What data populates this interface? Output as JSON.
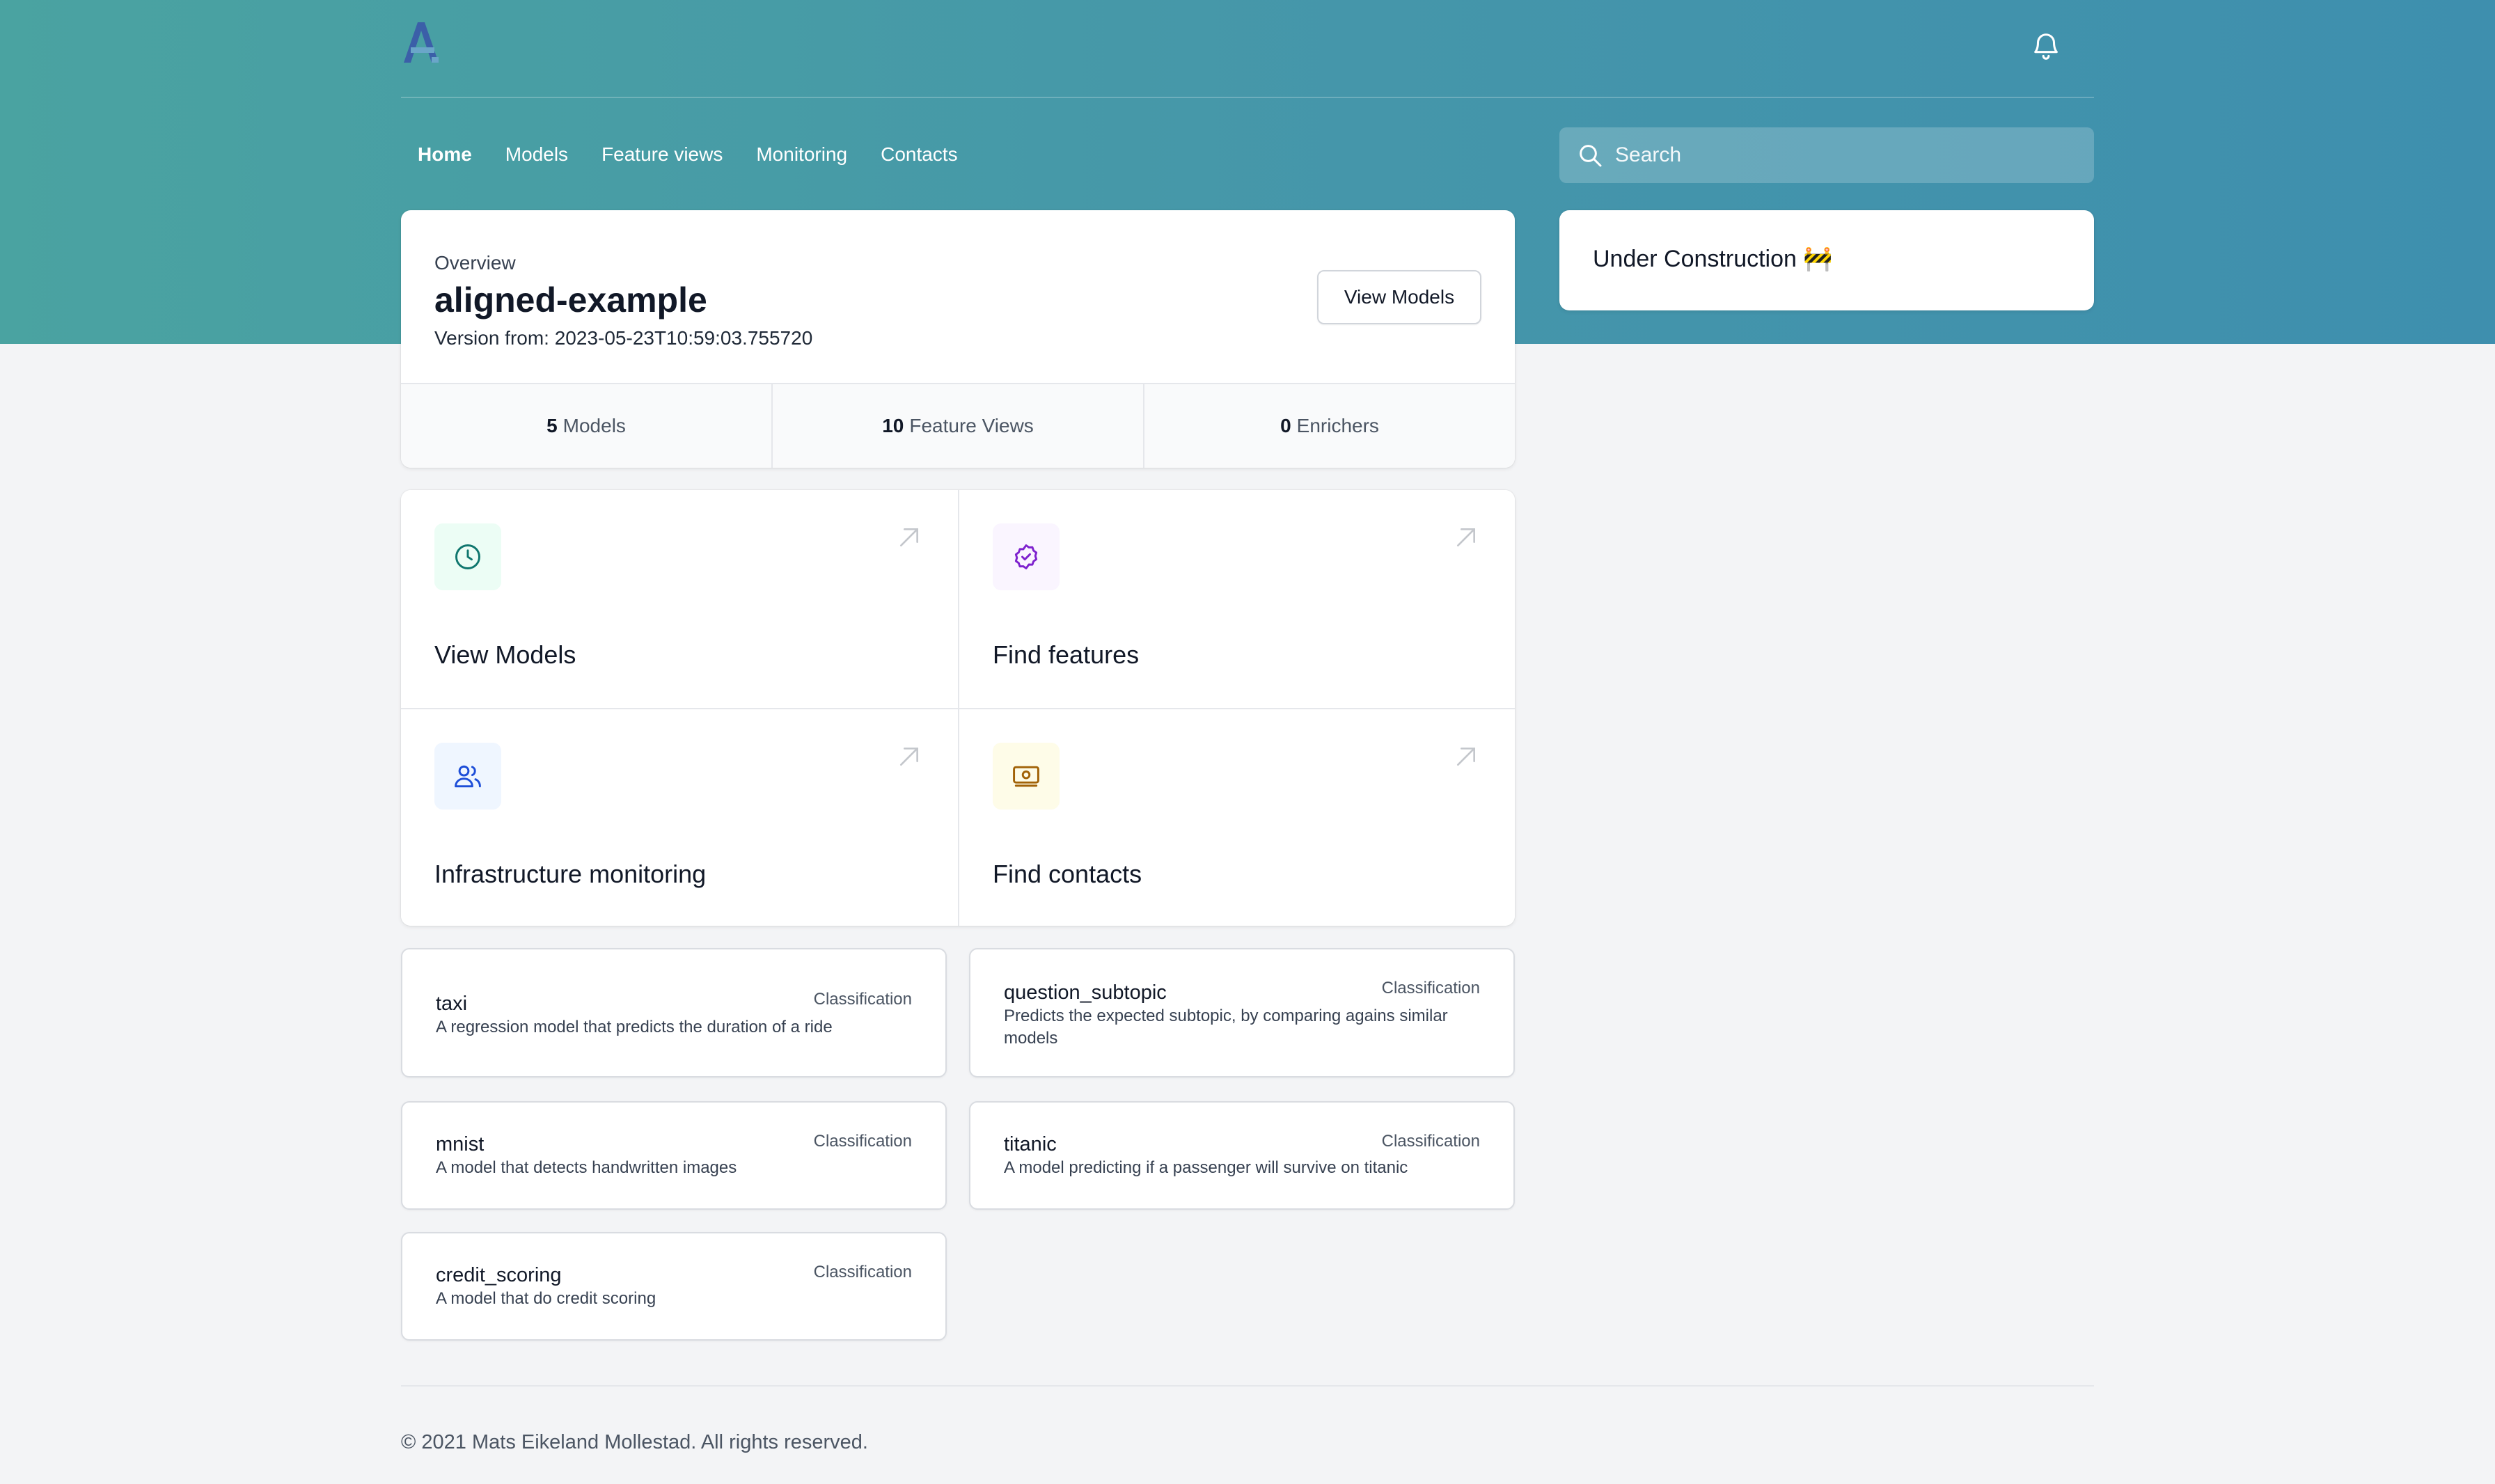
{
  "colors": {
    "hero_start": "#4aa3a1",
    "hero_end": "#3e8fae",
    "page_bg": "#f3f4f6",
    "logo": "#3b5fa8",
    "models_icon_bg": "#ecfdf5",
    "models_icon": "#0f766e",
    "features_icon_bg": "#faf5ff",
    "features_icon": "#7e22ce",
    "monitoring_icon_bg": "#eff6ff",
    "monitoring_icon": "#1d4ed8",
    "contacts_icon_bg": "#fefce8",
    "contacts_icon": "#a16207"
  },
  "header": {
    "logo_icon": "aligned-logo-icon",
    "notifications_icon": "bell-icon"
  },
  "nav": {
    "items": [
      {
        "label": "Home",
        "active": true
      },
      {
        "label": "Models"
      },
      {
        "label": "Feature views"
      },
      {
        "label": "Monitoring"
      },
      {
        "label": "Contacts"
      }
    ]
  },
  "search": {
    "placeholder": "Search",
    "value": "",
    "icon": "search-icon"
  },
  "overview": {
    "label": "Overview",
    "title": "aligned-example",
    "version": "Version from: 2023-05-23T10:59:03.755720",
    "button_label": "View Models",
    "stats": [
      {
        "count": "5",
        "label": "Models"
      },
      {
        "count": "10",
        "label": "Feature Views"
      },
      {
        "count": "0",
        "label": "Enrichers"
      }
    ]
  },
  "side_panel": {
    "text": "Under Construction 🚧"
  },
  "actions": [
    {
      "title": "View Models",
      "icon": "clock-icon"
    },
    {
      "title": "Find features",
      "icon": "badge-check-icon"
    },
    {
      "title": "Infrastructure monitoring",
      "icon": "users-icon"
    },
    {
      "title": "Find contacts",
      "icon": "banknote-icon"
    }
  ],
  "models": [
    {
      "name": "taxi",
      "type": "Classification",
      "description": "A regression model that predicts the duration of a ride"
    },
    {
      "name": "question_subtopic",
      "type": "Classification",
      "description": "Predicts the expected subtopic, by comparing agains similar models"
    },
    {
      "name": "mnist",
      "type": "Classification",
      "description": "A model that detects handwritten images"
    },
    {
      "name": "titanic",
      "type": "Classification",
      "description": "A model predicting if a passenger will survive on titanic"
    },
    {
      "name": "credit_scoring",
      "type": "Classification",
      "description": "A model that do credit scoring"
    }
  ],
  "footer": {
    "text": "© 2021 Mats Eikeland Mollestad. All rights reserved."
  }
}
